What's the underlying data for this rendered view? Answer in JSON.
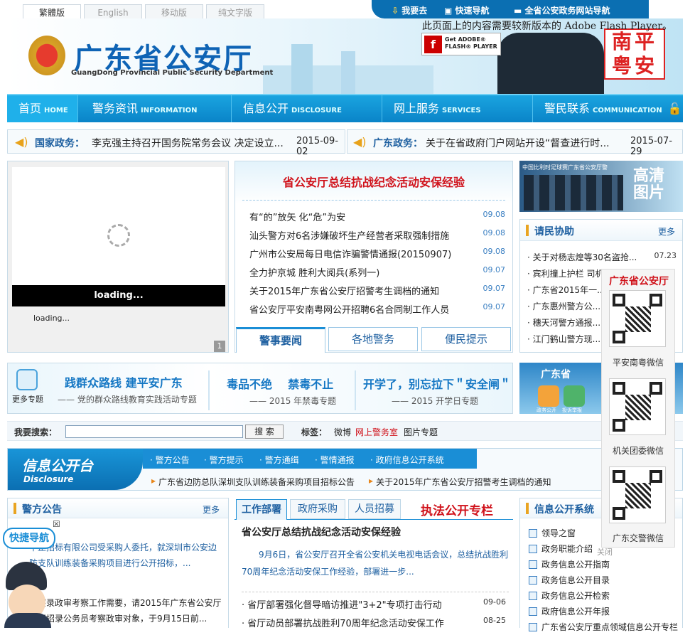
{
  "lang_tabs": [
    "繁體版",
    "English",
    "移动版",
    "纯文字版"
  ],
  "top_links": [
    "我要去",
    "快速导航",
    "全省公安政务网站导航"
  ],
  "flash_notice": "此页面上的内容需要较新版本的 Adobe Flash Player。",
  "flash_badge": {
    "line1": "Get ADOBE®",
    "line2": "FLASH® PLAYER"
  },
  "site": {
    "title": "广东省公安厅",
    "subtitle": "GuangDong Provincial Public Security Department",
    "logo_side": "南平粤安"
  },
  "nav": [
    {
      "label": "首页",
      "en": "HOME"
    },
    {
      "label": "警务资讯",
      "en": "INFORMATION"
    },
    {
      "label": "信息公开",
      "en": "DISCLOSURE"
    },
    {
      "label": "网上服务",
      "en": "SERVICES"
    },
    {
      "label": "警民联系",
      "en": "COMMUNICATION"
    }
  ],
  "ticker": {
    "national_label": "国家政务：",
    "national_text": "李克强主持召开国务院常务会议 决定设立...",
    "national_date": "2015-09-02",
    "gd_label": "广东政务：",
    "gd_text": "关于在省政府门户网站开设“督查进行时...",
    "gd_date": "2015-07-29"
  },
  "slideshow": {
    "loading_bar": "loading...",
    "loading_text": "loading...",
    "page": "1"
  },
  "news": {
    "headline": "省公安厅总结抗战纪念活动安保经验",
    "items": [
      {
        "t": "有“的”放矢 化“危”为安",
        "d": "09.08"
      },
      {
        "t": "汕头警方对6名涉嫌破坏生产经营者采取强制措施",
        "d": "09.08"
      },
      {
        "t": "广州市公安局每日电信诈骗警情通报(20150907)",
        "d": "09.08"
      },
      {
        "t": "全力护京城 胜利大阅兵(系列一)",
        "d": "09.07"
      },
      {
        "t": "关于2015年广东省公安厅招警考生调档的通知",
        "d": "09.07"
      },
      {
        "t": "省公安厅平安南粤网公开招聘6名合同制工作人员",
        "d": "09.07"
      }
    ],
    "tabs": [
      "警事要闻",
      "各地警务",
      "便民提示"
    ]
  },
  "photo_banner": {
    "t1": "高清",
    "t2": "图片",
    "caption": "中国比利时足球赛广东省公安厅警"
  },
  "assist": {
    "title": "请民协助",
    "more": "更多",
    "items": [
      {
        "t": "关于对杨志煌等30名盗抢...",
        "d": "07.23"
      },
      {
        "t": "宾利撞上护栏 司机...",
        "d": ""
      },
      {
        "t": "广东省2015年一...",
        "d": ""
      },
      {
        "t": "广东惠州警方公...",
        "d": ""
      },
      {
        "t": "穗天河警方通报...",
        "d": ""
      },
      {
        "t": "江门鹤山警方现...",
        "d": ""
      }
    ]
  },
  "specials": {
    "more": "更多专题",
    "s1_title": "践群众路线 建平安广东",
    "s1_sub": "—— 党的群众路线教育实践活动专题",
    "s2_title1": "毒品不绝",
    "s2_title2": "禁毒不止",
    "s2_sub": "—— 2015 年禁毒专题",
    "s3_title": "开学了，别忘拉下＂安全闸＂",
    "s3_sub": "—— 2015 开学日专题",
    "right": "广东省",
    "right_icons": [
      "政务公开",
      "投诉举报"
    ]
  },
  "search": {
    "label": "我要搜索：",
    "value": "",
    "button": "搜 索",
    "tags_label": "标签：",
    "tags": [
      "微博",
      "网上警务室",
      "图片专题"
    ]
  },
  "disclosure": {
    "logo": "信息公开台",
    "logo_en": "Disclosure",
    "menu": [
      "· 警方公告",
      "· 警方提示",
      "· 警方通缉",
      "· 警情通报",
      "· 政府信息公开系统"
    ],
    "notices": [
      "广东省边防总队深圳支队训练装备采购项目招标公告",
      "关于2015年广东省公安厅招警考生调档的通知"
    ]
  },
  "announce": {
    "title": "警方公告",
    "more": "更多",
    "p1": "中正招标有限公司受采购人委托，就深圳市公安边防支队训练装备采购项目进行公开招标，...",
    "p2": "考察录政审考察工作需要，请2015年广东省公安厅公开招录公务员考察政审对象，于9月15日前..."
  },
  "work": {
    "tabs": [
      "工作部署",
      "政府采购",
      "人员招募"
    ],
    "law_title": "执法公开专栏",
    "headline": "省公安厅总结抗战纪念活动安保经验",
    "summary": "9月6日，省公安厅召开全省公安机关电视电话会议，总结抗战胜利70周年纪念活动安保工作经验，部署进一步...",
    "items": [
      {
        "t": "· 省厅部署强化督导暗访推进\"3+2\"专项打击行动",
        "d": "09-06"
      },
      {
        "t": "· 省厅动员部署抗战胜利70周年纪念活动安保工作",
        "d": "08-25"
      }
    ]
  },
  "sys": {
    "title": "信息公开系统",
    "items": [
      "领导之窗",
      "政务职能介绍",
      "政务信息公开指南",
      "政务信息公开目录",
      "政务信息公开检索",
      "政府信息公开年报",
      "广东省公安厅重点领域信息公开专栏"
    ]
  },
  "floating": {
    "title": "广东省公安厅",
    "c1": "平安南粤微信",
    "c2": "机关团委微信",
    "c3": "广东交警微信",
    "close": "关闭"
  },
  "quicknav": {
    "label": "快捷导航",
    "close": "☒"
  }
}
